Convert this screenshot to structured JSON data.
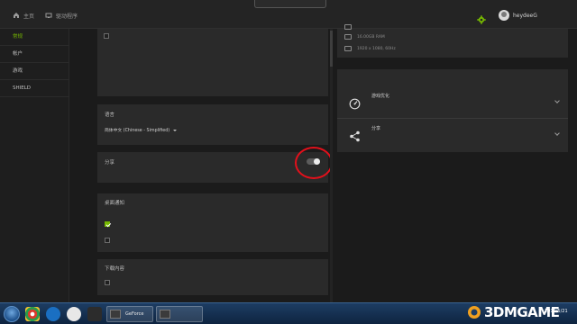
{
  "header": {
    "home_label": "主页",
    "drivers_label": "驱动程序",
    "logo_text": "",
    "username": "heydeeG",
    "accent": "#76b900"
  },
  "sidebar": {
    "items": [
      {
        "label": "常规",
        "active": true
      },
      {
        "label": "帐户",
        "active": false
      },
      {
        "label": "游戏",
        "active": false
      },
      {
        "label": "SHIELD",
        "active": false
      }
    ]
  },
  "settings": {
    "experimental_checkbox": {
      "label": "",
      "checked": false
    },
    "links": [
      "",
      "",
      "",
      ""
    ],
    "language": {
      "title": "语言",
      "selected": "简体中文 (Chinese - Simplified)"
    },
    "share": {
      "title": "分享",
      "description": "",
      "toggle_on": false
    },
    "notifications": {
      "title": "桌面通知",
      "subtitle": "",
      "items": [
        {
          "label": "",
          "checked": true
        },
        {
          "label": "",
          "checked": false
        }
      ]
    },
    "downloads": {
      "title": "下载内容",
      "items": [
        {
          "label": "",
          "checked": false
        }
      ]
    }
  },
  "right_panel": {
    "system_rows": [
      "",
      "16.00GB RAM",
      "1920 x 1080, 60Hz"
    ],
    "features": {
      "title": "",
      "items": [
        {
          "title": "游戏优化",
          "line1": "",
          "line2": "",
          "icon": "speedometer-icon"
        },
        {
          "title": "分享",
          "line1": "",
          "line2": "",
          "icon": "share-icon"
        }
      ]
    }
  },
  "taskbar": {
    "tasks": [
      {
        "label": "GeForce Ex..."
      },
      {
        "label": ""
      }
    ],
    "clock": "2019/5/21",
    "watermark": "3DMGAME"
  }
}
